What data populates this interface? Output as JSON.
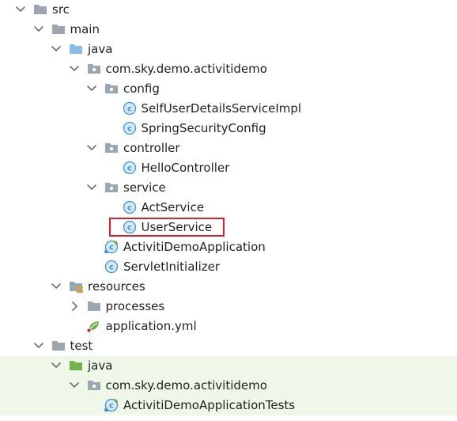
{
  "project_tree": {
    "items": [
      {
        "label": "src",
        "depth": 0,
        "arrow": "down",
        "icon": "folder"
      },
      {
        "label": "main",
        "depth": 1,
        "arrow": "down",
        "icon": "folder"
      },
      {
        "label": "java",
        "depth": 2,
        "arrow": "down",
        "icon": "folder-source"
      },
      {
        "label": "com.sky.demo.activitidemo",
        "depth": 3,
        "arrow": "down",
        "icon": "package"
      },
      {
        "label": "config",
        "depth": 4,
        "arrow": "down",
        "icon": "package"
      },
      {
        "label": "SelfUserDetailsServiceImpl",
        "depth": 5,
        "arrow": "none",
        "icon": "class"
      },
      {
        "label": "SpringSecurityConfig",
        "depth": 5,
        "arrow": "none",
        "icon": "class"
      },
      {
        "label": "controller",
        "depth": 4,
        "arrow": "down",
        "icon": "package"
      },
      {
        "label": "HelloController",
        "depth": 5,
        "arrow": "none",
        "icon": "class"
      },
      {
        "label": "service",
        "depth": 4,
        "arrow": "down",
        "icon": "package"
      },
      {
        "label": "ActService",
        "depth": 5,
        "arrow": "none",
        "icon": "class"
      },
      {
        "label": "UserService",
        "depth": 5,
        "arrow": "none",
        "icon": "class",
        "highlighted": true
      },
      {
        "label": "ActivitiDemoApplication",
        "depth": 4,
        "arrow": "none",
        "icon": "spring-class"
      },
      {
        "label": "ServletInitializer",
        "depth": 4,
        "arrow": "none",
        "icon": "class"
      },
      {
        "label": "resources",
        "depth": 2,
        "arrow": "down",
        "icon": "folder-resources"
      },
      {
        "label": "processes",
        "depth": 3,
        "arrow": "right",
        "icon": "folder"
      },
      {
        "label": "application.yml",
        "depth": 3,
        "arrow": "none",
        "icon": "yml"
      },
      {
        "label": "test",
        "depth": 1,
        "arrow": "down",
        "icon": "folder"
      },
      {
        "label": "java",
        "depth": 2,
        "arrow": "down",
        "icon": "folder-test",
        "tinted": true
      },
      {
        "label": "com.sky.demo.activitidemo",
        "depth": 3,
        "arrow": "down",
        "icon": "package",
        "tinted": true
      },
      {
        "label": "ActivitiDemoApplicationTests",
        "depth": 4,
        "arrow": "none",
        "icon": "spring-class",
        "tinted": true
      }
    ]
  },
  "colors": {
    "folder": "#9aa7b0",
    "source_folder": "#87bde6",
    "test_folder": "#72b14b",
    "test_row_bg": "#eff7e8",
    "class_icon": "#3f93d1",
    "spring": "#6cae3e",
    "highlight": "#d3232a",
    "arrow": "#6e6e6e",
    "text": "#1f1f1f"
  }
}
